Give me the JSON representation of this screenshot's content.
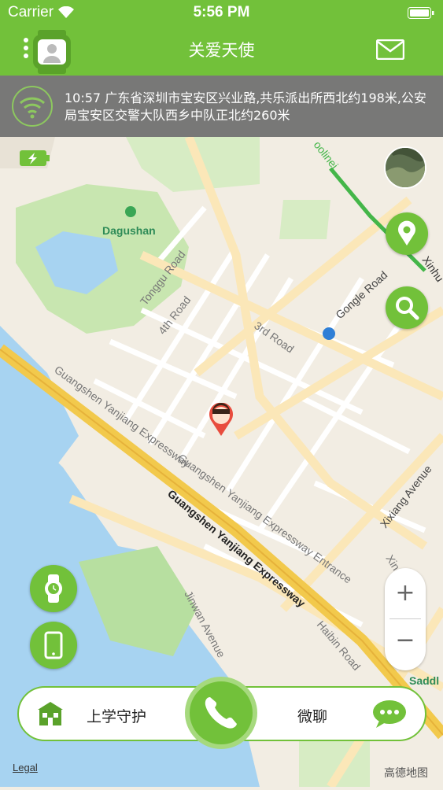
{
  "status_bar": {
    "carrier": "Carrier",
    "time": "5:56 PM"
  },
  "nav": {
    "title": "关爱天使"
  },
  "notice": {
    "text": "10:57  广东省深圳市宝安区兴业路,共乐派出所西北约198米,公安局宝安区交警大队西乡中队正北约260米"
  },
  "map": {
    "labels": {
      "park": "Dagushan",
      "tonggu": "Tonggu Road",
      "fourth": "4th Road",
      "third": "3rd Road",
      "gongle": "Gongle Road",
      "guangshen_lower": "Guangshen Yanjiang Expressway",
      "guangshen_entrance": "Guangshen Yanjiang Expressway Entrance",
      "guangshen_main": "Guangshen Yanjiang Expressway",
      "xixiang": "Xixiang Avenue",
      "xinhu": "Xinhu",
      "tine": "oolinei",
      "jinwan": "Jinwan Avenue",
      "haibin": "Haibin Road",
      "xingye": "Xingye Road",
      "saddl": "Saddl",
      "legal": "Legal",
      "gaode": "高德地图"
    }
  },
  "zoom": {
    "plus": "+",
    "minus": "−"
  },
  "bottom": {
    "school": "上学守护",
    "chat": "微聊"
  },
  "colors": {
    "accent": "#72c13a",
    "accent_light": "#a6d97e",
    "notice_bg": "#6e6e6e"
  }
}
